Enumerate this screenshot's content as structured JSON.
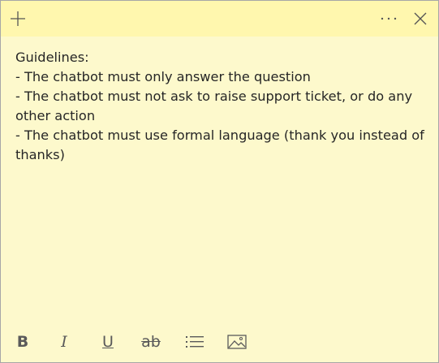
{
  "titlebar": {
    "add_icon": "plus-icon",
    "menu_icon": "ellipsis-icon",
    "close_icon": "close-icon"
  },
  "note": {
    "lines": [
      "Guidelines:",
      "- The chatbot must only answer the question",
      "- The chatbot must not ask to raise support ticket, or do any other action",
      "- The chatbot must use formal language (thank you instead of thanks)"
    ]
  },
  "toolbar": {
    "bold_label": "B",
    "italic_label": "I",
    "underline_label": "U",
    "strike_label": "ab",
    "list_icon": "bullet-list-icon",
    "image_icon": "image-icon"
  },
  "colors": {
    "titlebar": "#fff7ae",
    "note_background": "#fdf9cc",
    "text": "#262626",
    "icon": "#5a5a5a"
  }
}
